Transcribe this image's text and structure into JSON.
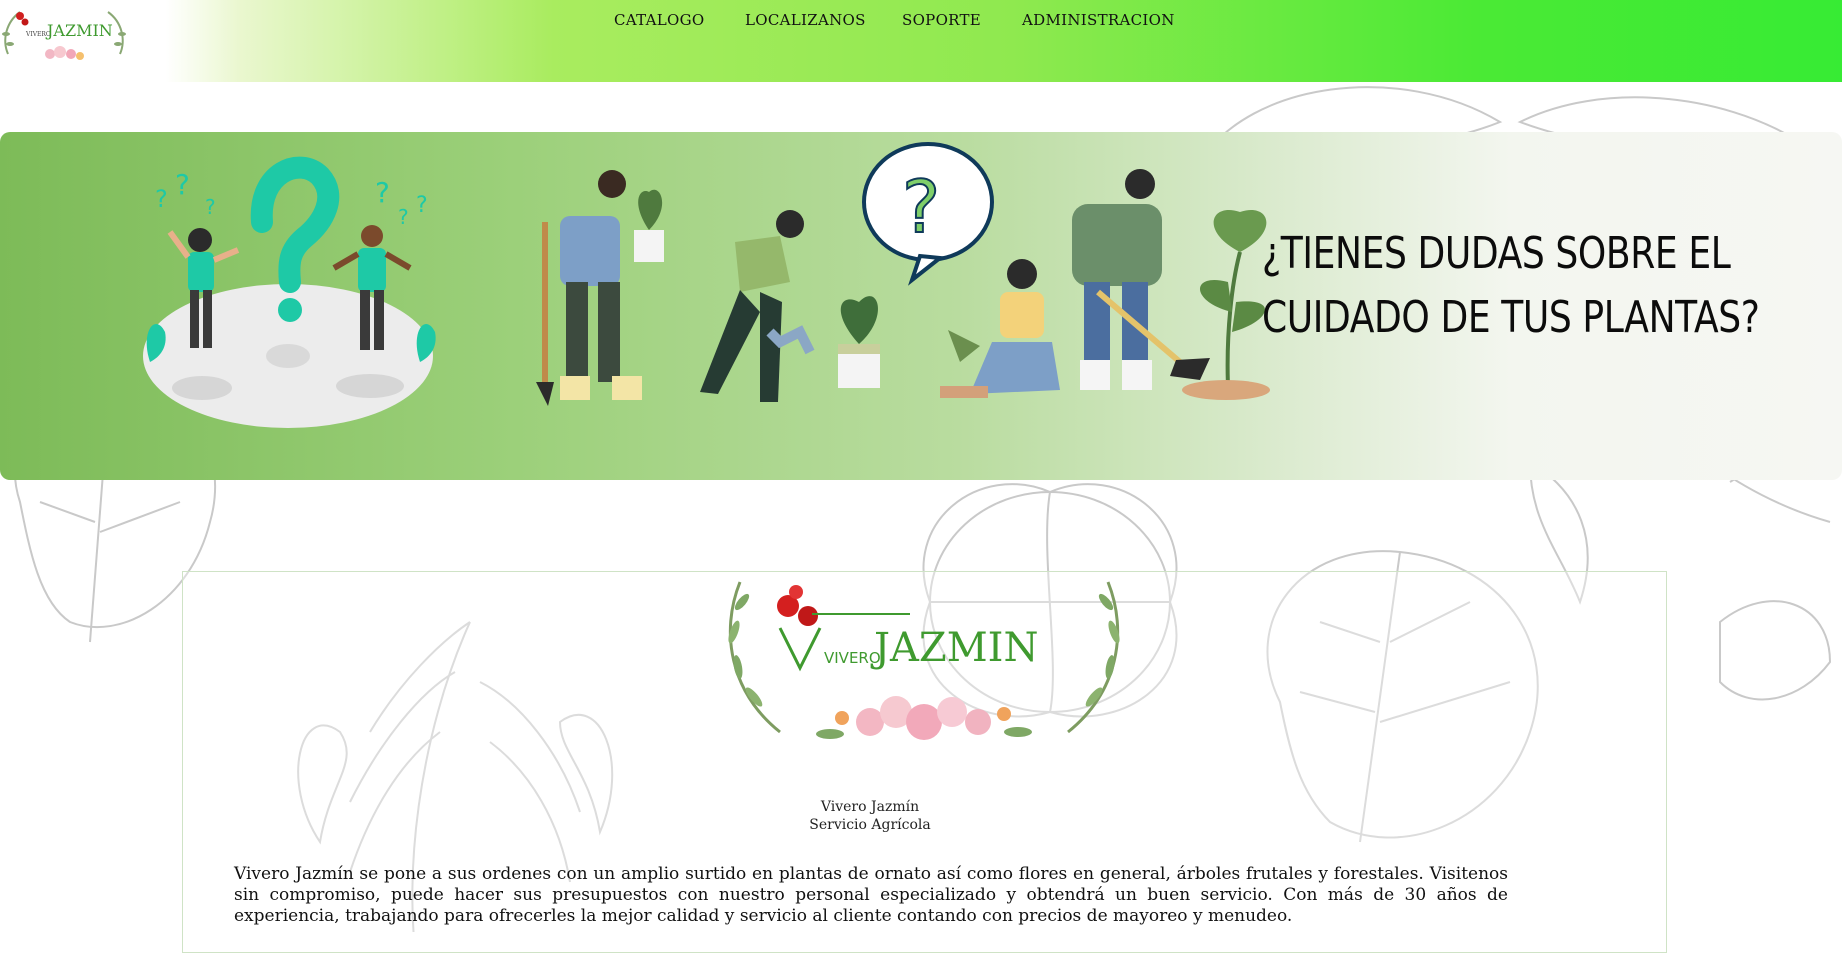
{
  "brand": {
    "logo_prefix": "VIVERO",
    "logo_name": "JAZMIN"
  },
  "nav": {
    "items": [
      {
        "label": "CATALOGO"
      },
      {
        "label": "LOCALIZANOS"
      },
      {
        "label": "SOPORTE"
      },
      {
        "label": "ADMINISTRACION"
      }
    ]
  },
  "banner": {
    "heading_line1": "¿TIENES DUDAS SOBRE EL",
    "heading_line2": "CUIDADO DE TUS PLANTAS?"
  },
  "content": {
    "tagline_line1": "Vivero Jazmín",
    "tagline_line2": "Servicio Agrícola",
    "description": "Vivero Jazmín se pone a sus ordenes con un amplio surtido en plantas de ornato así como flores en general, árboles frutales y forestales. Visitenos sin compromiso, puede hacer sus presupuestos con nuestro personal especializado y obtendrá un buen servicio. Con más de 30 años de experiencia, trabajando para ofrecerles la mejor calidad y servicio al cliente contando con precios de mayoreo y menudeo."
  },
  "colors": {
    "header_gradient_start": "#a9ec5f",
    "header_gradient_end": "#37eb34",
    "banner_green": "#7dbb58",
    "logo_green": "#3f9a2f",
    "card_border": "#cfe3c6"
  },
  "icons": [
    "rose-icon",
    "leaf-wreath-icon",
    "question-mark-icon",
    "plant-icon"
  ]
}
